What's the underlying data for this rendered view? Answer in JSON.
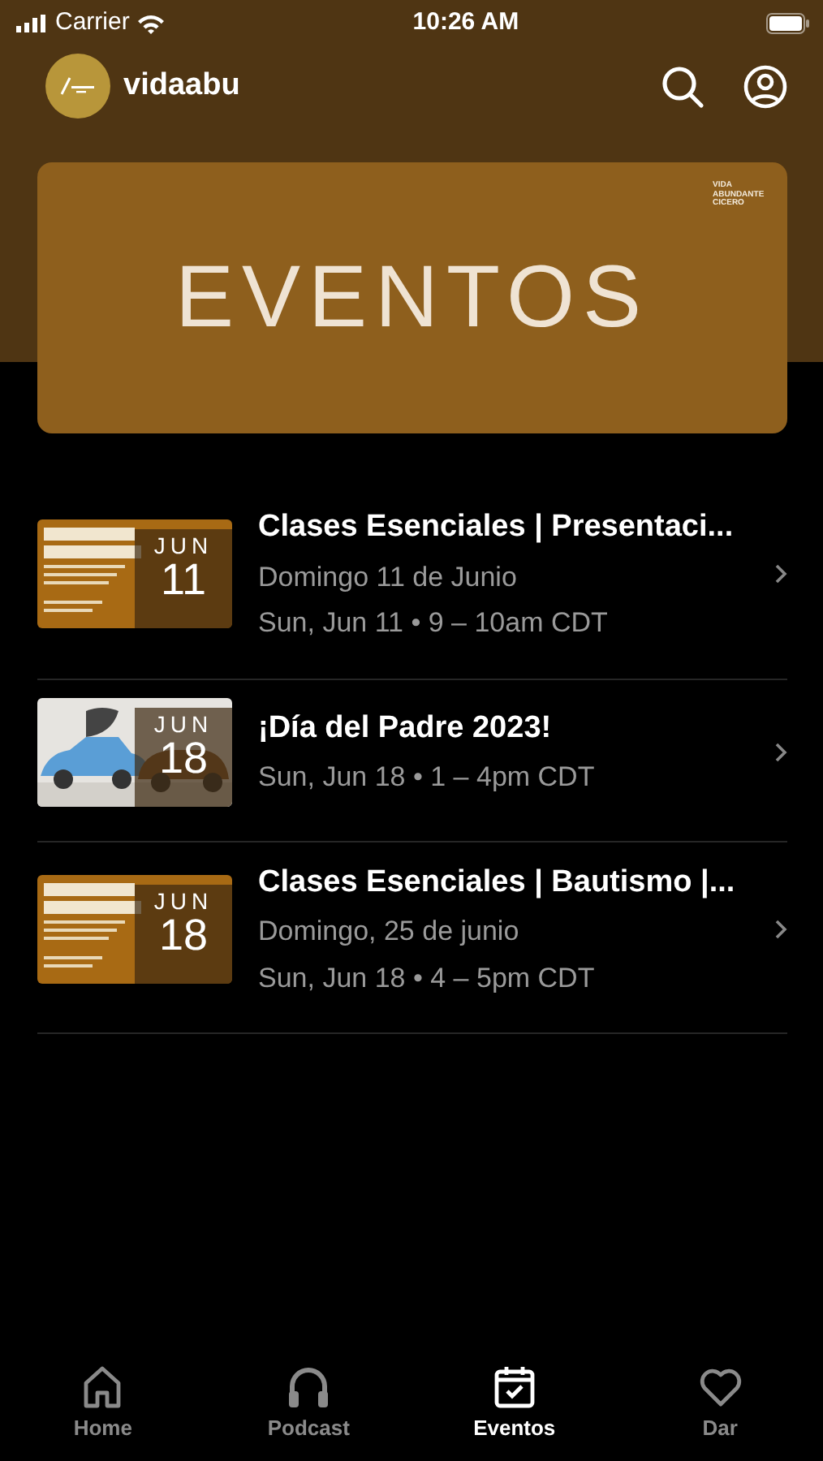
{
  "status_bar": {
    "carrier": "Carrier",
    "time": "10:26 AM"
  },
  "header": {
    "title": "vidaabu"
  },
  "banner": {
    "title": "EVENTOS",
    "logo_text": "VIDA ABUNDANTE CICERO"
  },
  "events": [
    {
      "title": "Clases Esenciales | Presentaci...",
      "lines": [
        "Domingo 11 de Junio",
        "Sun, Jun 11 • 9 – 10am CDT"
      ],
      "month": "JUN",
      "day": "11"
    },
    {
      "title": "¡Día del Padre 2023!",
      "lines": [
        "Sun, Jun 18 • 1 – 4pm CDT"
      ],
      "month": "JUN",
      "day": "18"
    },
    {
      "title": "Clases Esenciales | Bautismo |...",
      "lines": [
        "Domingo, 25 de junio",
        "Sun, Jun 18 • 4 – 5pm CDT"
      ],
      "month": "JUN",
      "day": "18"
    }
  ],
  "tabs": [
    {
      "label": "Home",
      "selected": false
    },
    {
      "label": "Podcast",
      "selected": false
    },
    {
      "label": "Eventos",
      "selected": true
    },
    {
      "label": "Dar",
      "selected": false
    }
  ]
}
